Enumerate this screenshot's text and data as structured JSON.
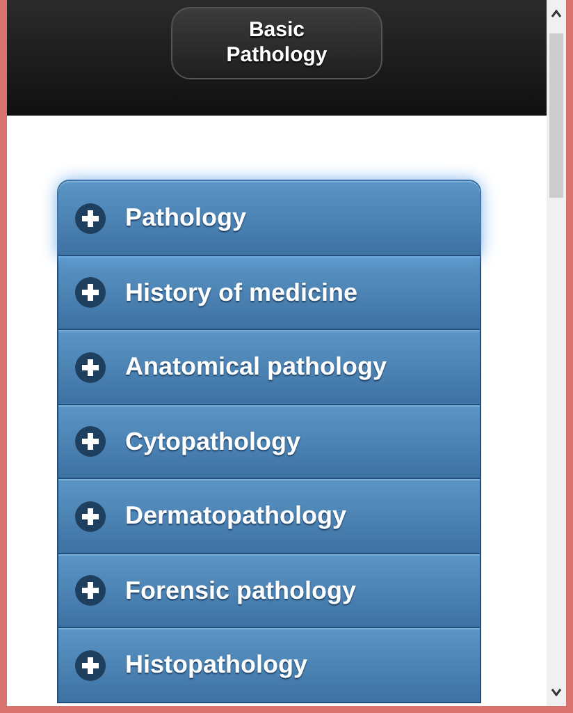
{
  "header": {
    "title": "Basic\nPathology"
  },
  "topics": [
    {
      "label": "Pathology",
      "expanded": false,
      "focused": true
    },
    {
      "label": "History of medicine",
      "expanded": false,
      "focused": false
    },
    {
      "label": "Anatomical pathology",
      "expanded": false,
      "focused": false
    },
    {
      "label": "Cytopathology",
      "expanded": false,
      "focused": false
    },
    {
      "label": "Dermatopathology",
      "expanded": false,
      "focused": false
    },
    {
      "label": "Forensic pathology",
      "expanded": false,
      "focused": false
    },
    {
      "label": "Histopathology",
      "expanded": false,
      "focused": false
    }
  ]
}
